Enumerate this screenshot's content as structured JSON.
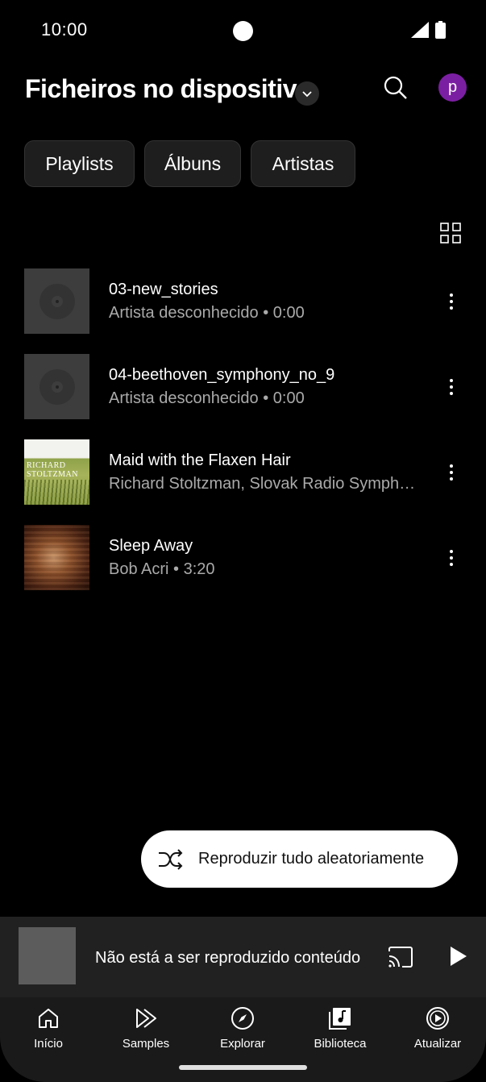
{
  "status_bar": {
    "time": "10:00"
  },
  "header": {
    "title": "Ficheiros no dispositivo",
    "avatar_letter": "p",
    "avatar_color": "#7b1fa2"
  },
  "chips": [
    {
      "label": "Playlists"
    },
    {
      "label": "Álbuns"
    },
    {
      "label": "Artistas"
    }
  ],
  "tracks": [
    {
      "title": "03-new_stories",
      "subtitle": "Artista desconhecido • 0:00",
      "art": "vinyl-placeholder"
    },
    {
      "title": "04-beethoven_symphony_no_9",
      "subtitle": "Artista desconhecido • 0:00",
      "art": "vinyl-placeholder"
    },
    {
      "title": "Maid with the Flaxen Hair",
      "subtitle": "Richard Stoltzman, Slovak Radio Symphony Orchestra",
      "art": "album-cover-richard-stoltzman",
      "art_text": "RICHARD STOLTZMAN"
    },
    {
      "title": "Sleep Away",
      "subtitle": "Bob Acri • 3:20",
      "art": "album-cover-bob-acri"
    }
  ],
  "shuffle": {
    "label": "Reproduzir tudo aleatoriamente"
  },
  "mini_player": {
    "label": "Não está a ser reproduzido conteúdo"
  },
  "nav": [
    {
      "label": "Início",
      "icon": "home-icon"
    },
    {
      "label": "Samples",
      "icon": "samples-icon"
    },
    {
      "label": "Explorar",
      "icon": "compass-icon"
    },
    {
      "label": "Biblioteca",
      "icon": "library-icon"
    },
    {
      "label": "Atualizar",
      "icon": "upgrade-icon"
    }
  ]
}
